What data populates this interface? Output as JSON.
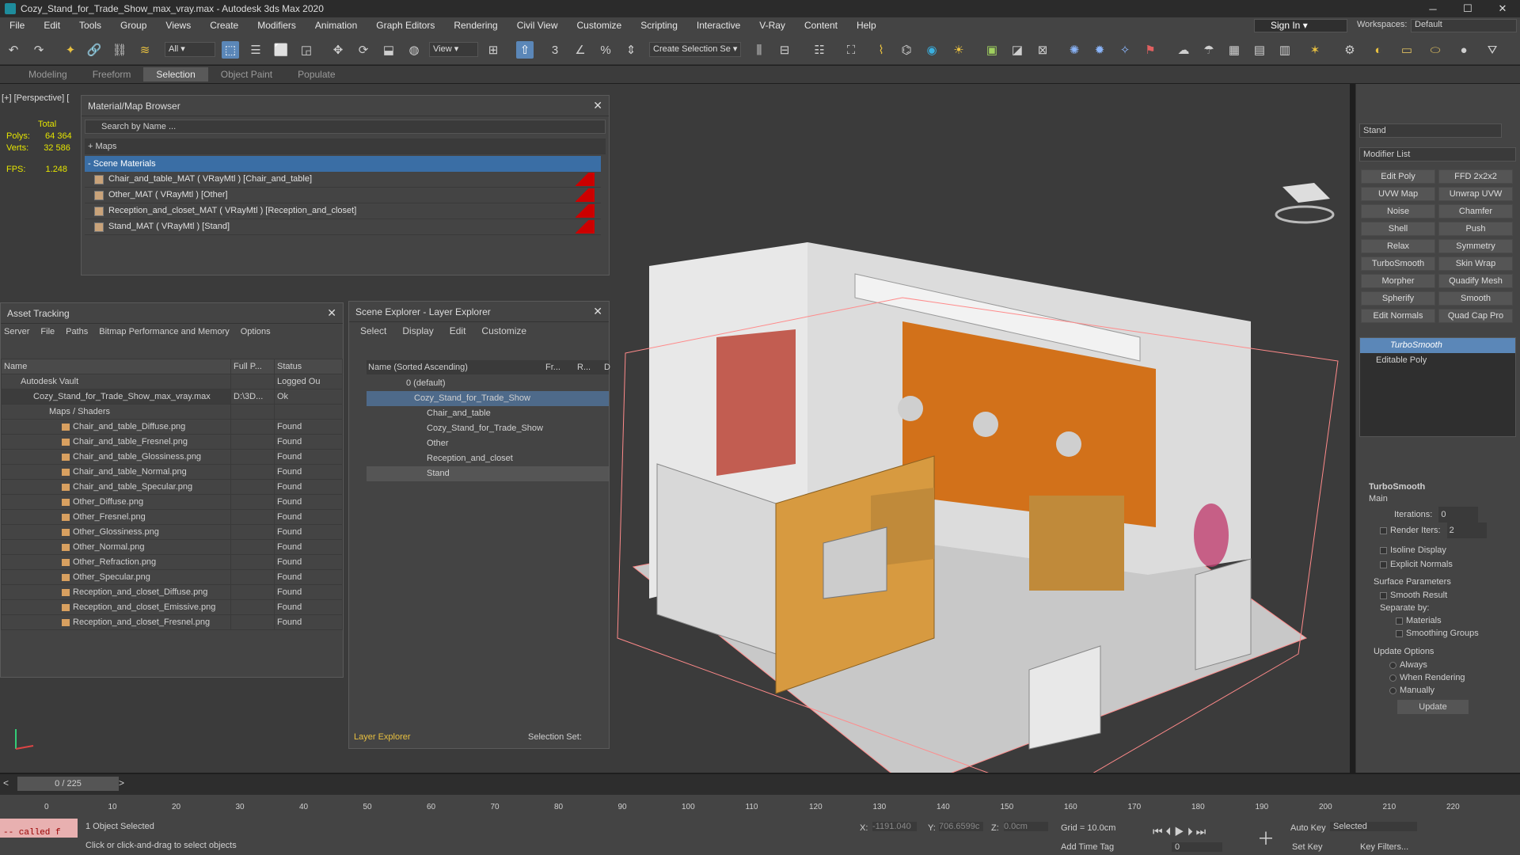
{
  "window": {
    "title": "Cozy_Stand_for_Trade_Show_max_vray.max - Autodesk 3ds Max 2020",
    "min": "─",
    "max": "☐",
    "close": "✕"
  },
  "menu": [
    "File",
    "Edit",
    "Tools",
    "Group",
    "Views",
    "Create",
    "Modifiers",
    "Animation",
    "Graph Editors",
    "Rendering",
    "Civil View",
    "Customize",
    "Scripting",
    "Interactive",
    "V-Ray",
    "Content",
    "Help"
  ],
  "signin": "Sign In",
  "workspaces_label": "Workspaces:",
  "workspace": "Default",
  "toolbar": {
    "filter": "All",
    "view": "View",
    "create_selection": "Create Selection Se"
  },
  "ribbon": [
    "Modeling",
    "Freeform",
    "Selection",
    "Object Paint",
    "Populate"
  ],
  "viewport": {
    "label": "[+] [Perspective] [",
    "stats": {
      "total": "Total",
      "polys_label": "Polys:",
      "polys": "64 364",
      "verts_label": "Verts:",
      "verts": "32 586",
      "fps_label": "FPS:",
      "fps": "1.248"
    }
  },
  "material_browser": {
    "title": "Material/Map Browser",
    "search": "Search by Name ...",
    "maps": "+ Maps",
    "scene": "- Scene Materials",
    "items": [
      "Chair_and_table_MAT  ( VRayMtl )  [Chair_and_table]",
      "Other_MAT  ( VRayMtl )  [Other]",
      "Reception_and_closet_MAT  ( VRayMtl )  [Reception_and_closet]",
      "Stand_MAT  ( VRayMtl )  [Stand]"
    ]
  },
  "asset_tracking": {
    "title": "Asset Tracking",
    "menu": [
      "Server",
      "File",
      "Paths",
      "Bitmap Performance and Memory",
      "Options"
    ],
    "cols": [
      "Name",
      "Full P...",
      "Status"
    ],
    "rows": [
      [
        "Autodesk Vault",
        "",
        "Logged Ou"
      ],
      [
        "Cozy_Stand_for_Trade_Show_max_vray.max",
        "D:\\3D...",
        "Ok"
      ],
      [
        "Maps / Shaders",
        "",
        ""
      ],
      [
        "Chair_and_table_Diffuse.png",
        "",
        "Found"
      ],
      [
        "Chair_and_table_Fresnel.png",
        "",
        "Found"
      ],
      [
        "Chair_and_table_Glossiness.png",
        "",
        "Found"
      ],
      [
        "Chair_and_table_Normal.png",
        "",
        "Found"
      ],
      [
        "Chair_and_table_Specular.png",
        "",
        "Found"
      ],
      [
        "Other_Diffuse.png",
        "",
        "Found"
      ],
      [
        "Other_Fresnel.png",
        "",
        "Found"
      ],
      [
        "Other_Glossiness.png",
        "",
        "Found"
      ],
      [
        "Other_Normal.png",
        "",
        "Found"
      ],
      [
        "Other_Refraction.png",
        "",
        "Found"
      ],
      [
        "Other_Specular.png",
        "",
        "Found"
      ],
      [
        "Reception_and_closet_Diffuse.png",
        "",
        "Found"
      ],
      [
        "Reception_and_closet_Emissive.png",
        "",
        "Found"
      ],
      [
        "Reception_and_closet_Fresnel.png",
        "",
        "Found"
      ]
    ]
  },
  "scene_explorer": {
    "title": "Scene Explorer - Layer Explorer",
    "menu": [
      "Select",
      "Display",
      "Edit",
      "Customize"
    ],
    "col_name": "Name (Sorted Ascending)",
    "col_fr": "Fr...",
    "col_r": "R...",
    "col_d": "D",
    "rows": [
      "0 (default)",
      "Cozy_Stand_for_Trade_Show",
      "Chair_and_table",
      "Cozy_Stand_for_Trade_Show",
      "Other",
      "Reception_and_closet",
      "Stand"
    ],
    "footer": "Layer Explorer",
    "selset": "Selection Set:"
  },
  "command_panel": {
    "object": "Stand",
    "modlist": "Modifier List",
    "buttons": [
      "Edit Poly",
      "FFD 2x2x2",
      "UVW Map",
      "Unwrap UVW",
      "Noise",
      "Chamfer",
      "Shell",
      "Push",
      "Relax",
      "Symmetry",
      "TurboSmooth",
      "Skin Wrap",
      "Morpher",
      "Quadify Mesh",
      "Spherify",
      "Smooth",
      "Edit Normals",
      "Quad Cap Pro"
    ],
    "stack": [
      "TurboSmooth",
      "Editable Poly"
    ],
    "rollout": {
      "title": "TurboSmooth",
      "main": "Main",
      "iterations_label": "Iterations:",
      "iterations": "0",
      "render_iters_label": "Render Iters:",
      "render_iters": "2",
      "isoline": "Isoline Display",
      "explicit": "Explicit Normals",
      "surface": "Surface Parameters",
      "smooth_result": "Smooth Result",
      "separate": "Separate by:",
      "materials": "Materials",
      "smoothing": "Smoothing Groups",
      "update_options": "Update Options",
      "always": "Always",
      "when_rendering": "When Rendering",
      "manually": "Manually",
      "update": "Update"
    }
  },
  "timeline": {
    "frame": "0 / 225",
    "ticks": [
      "0",
      "10",
      "20",
      "30",
      "40",
      "50",
      "60",
      "70",
      "80",
      "90",
      "100",
      "110",
      "120",
      "130",
      "140",
      "150",
      "160",
      "170",
      "180",
      "190",
      "200",
      "210",
      "220"
    ]
  },
  "status": {
    "script": "-- called f",
    "selected": "1 Object Selected",
    "hint": "Click or click-and-drag to select objects",
    "x_label": "X:",
    "x": "-1191.040",
    "y_label": "Y:",
    "y": "706.6599c",
    "z_label": "Z:",
    "z": "0.0cm",
    "grid": "Grid = 10.0cm",
    "add_time_tag": "Add Time Tag",
    "auto_key": "Auto Key",
    "selected_dd": "Selected",
    "set_key": "Set Key",
    "key_filters": "Key Filters...",
    "frame": "0"
  }
}
